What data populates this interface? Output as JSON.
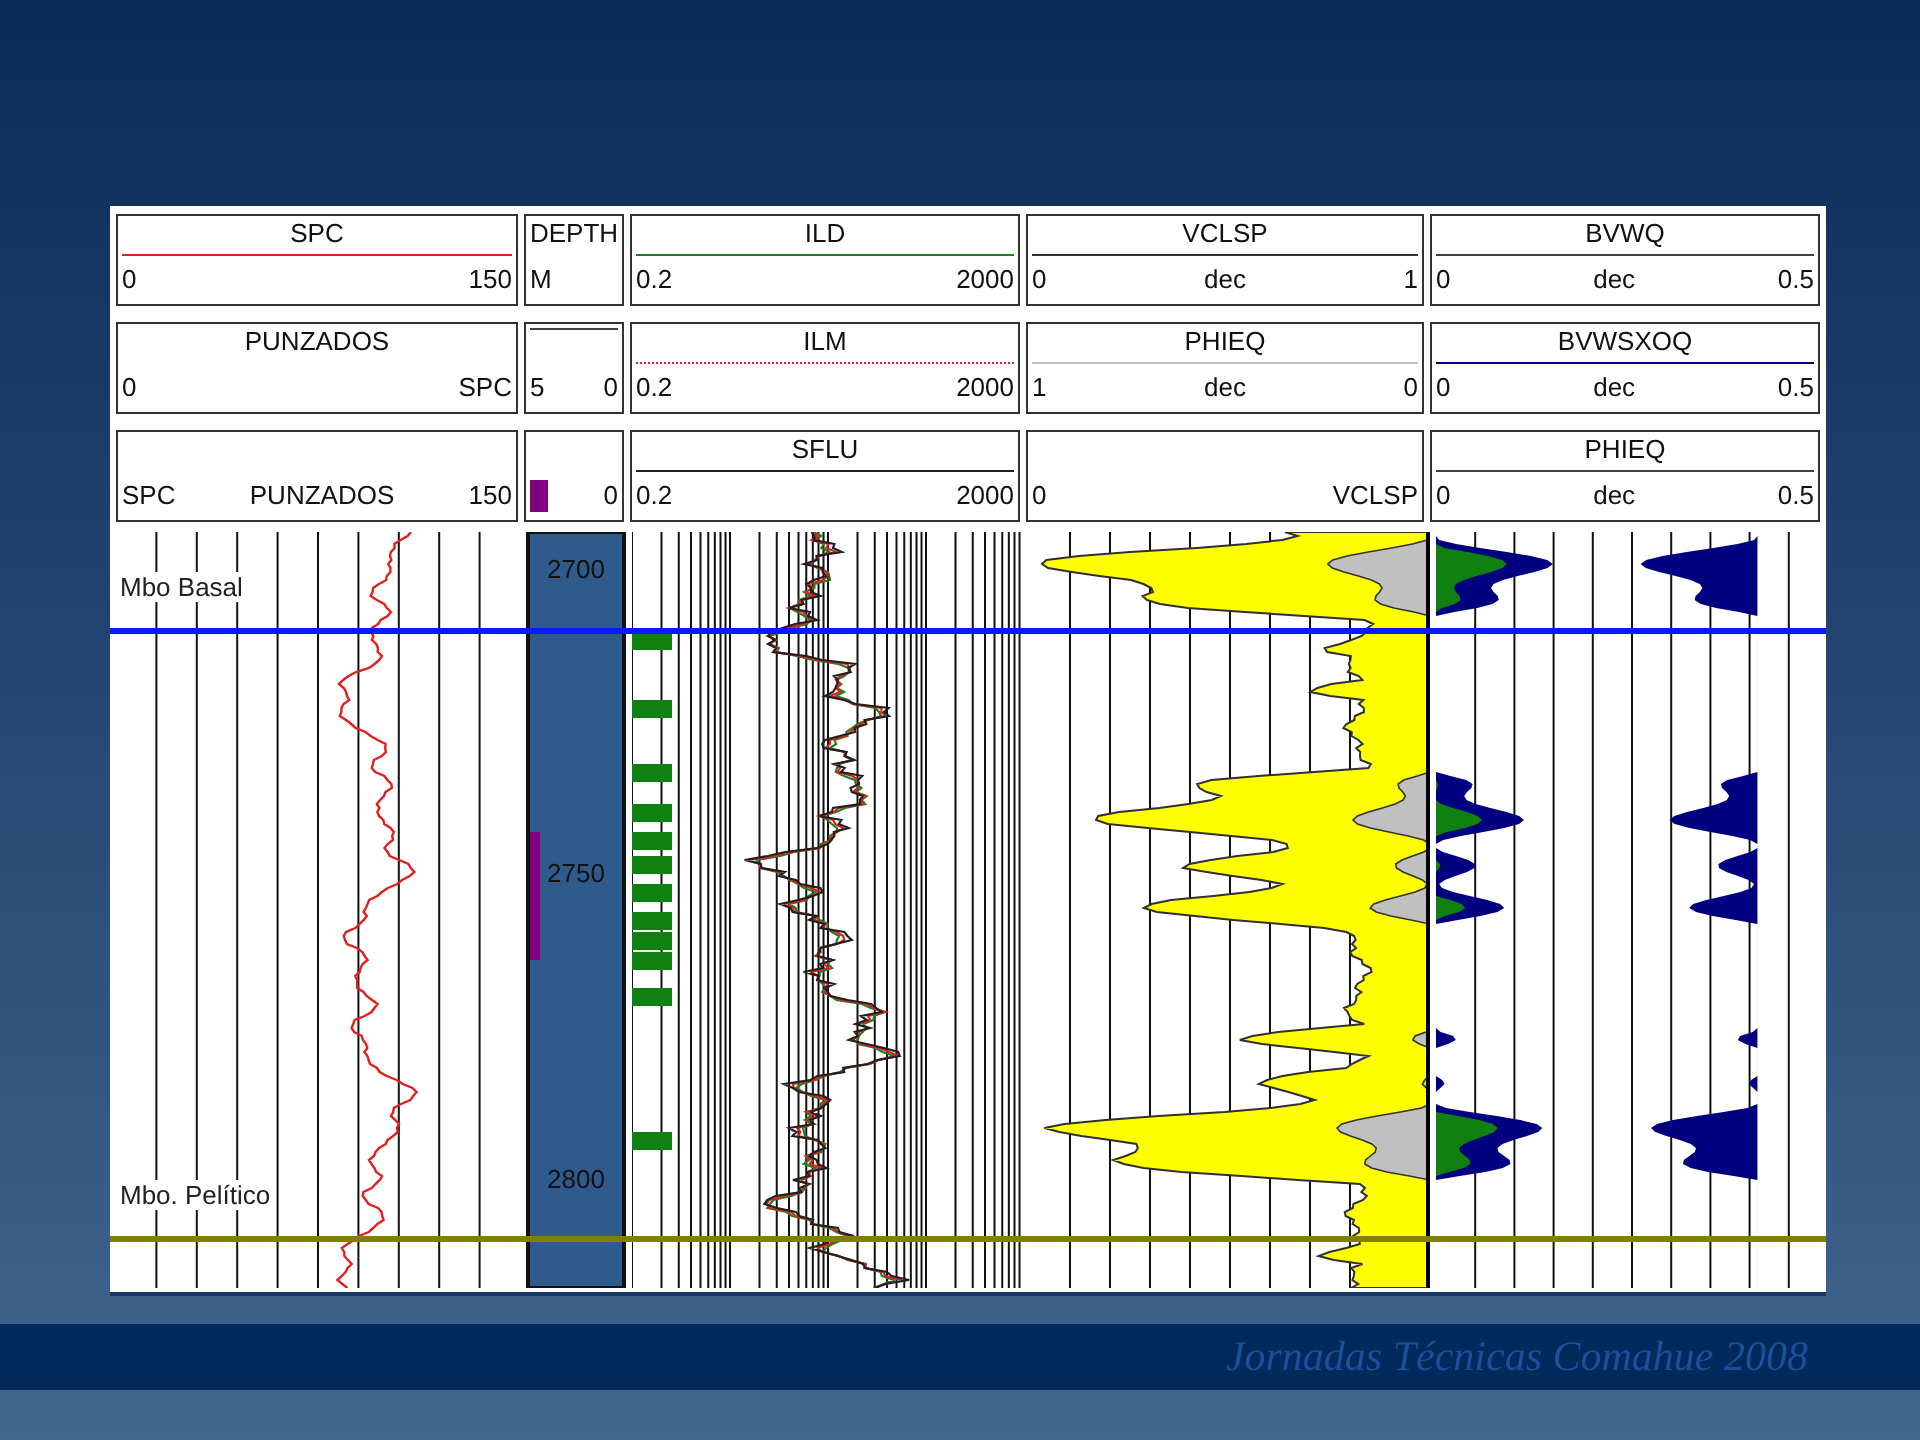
{
  "tracks": [
    {
      "kind": "spc",
      "headers": [
        {
          "title": "SPC",
          "scale": [
            "0",
            "150"
          ],
          "color": "#e02020",
          "underline": true,
          "dotted": false
        },
        {
          "title": "PUNZADOS",
          "scale": [
            "0",
            "SPC"
          ],
          "underline": false
        },
        {
          "scale": [
            "SPC",
            "PUNZADOS",
            "150"
          ],
          "underline": false
        }
      ]
    },
    {
      "kind": "depth",
      "headers": [
        {
          "title": "DEPTH",
          "scale": [
            "M"
          ],
          "underline": false
        },
        {
          "scale": [
            "5",
            "0"
          ],
          "color": "#404040",
          "underline": true,
          "dotted": false
        },
        {
          "color": "#800080",
          "swatch": true,
          "scale": [
            "0"
          ],
          "underline": false
        }
      ],
      "depth_labels": [
        "2700",
        "2750",
        "2800"
      ]
    },
    {
      "kind": "resistivity",
      "headers": [
        {
          "title": "ILD",
          "scale": [
            "0.2",
            "2000"
          ],
          "color": "#208020",
          "underline": true,
          "dotted": false
        },
        {
          "title": "ILM",
          "scale": [
            "0.2",
            "2000"
          ],
          "color": "#e02020",
          "underline": true,
          "dotted": true
        },
        {
          "title": "SFLU",
          "scale": [
            "0.2",
            "2000"
          ],
          "color": "#202020",
          "underline": true,
          "dotted": false
        }
      ]
    },
    {
      "kind": "shale",
      "headers": [
        {
          "title": "VCLSP",
          "scale": [
            "0",
            "dec",
            "1"
          ],
          "color": "#303030",
          "underline": true,
          "dotted": false
        },
        {
          "title": "PHIEQ",
          "scale": [
            "1",
            "dec",
            "0"
          ],
          "color": "#c0c0c0",
          "underline": true,
          "dotted": false
        },
        {
          "scale": [
            "0",
            "VCLSP"
          ],
          "color": "#ffff00",
          "underline": false
        }
      ]
    },
    {
      "kind": "fluids",
      "headers": [
        {
          "title": "BVWQ",
          "scale": [
            "0",
            "dec",
            "0.5"
          ],
          "color": "#404040",
          "underline": true,
          "dotted": false
        },
        {
          "title": "BVWSXOQ",
          "scale": [
            "0",
            "dec",
            "0.5"
          ],
          "color": "#000080",
          "underline": true,
          "dotted": false
        },
        {
          "title": "PHIEQ",
          "scale": [
            "0",
            "dec",
            "0.5"
          ],
          "color": "#404040",
          "underline": true,
          "dotted": false
        }
      ]
    }
  ],
  "formation_tops": [
    {
      "name": "Mbo Basal",
      "color": "#0a1aff"
    },
    {
      "name": "Mbo. Pelítico",
      "color": "#7f7f00"
    }
  ],
  "footer": "Jornadas Técnicas Comahue 2008"
}
